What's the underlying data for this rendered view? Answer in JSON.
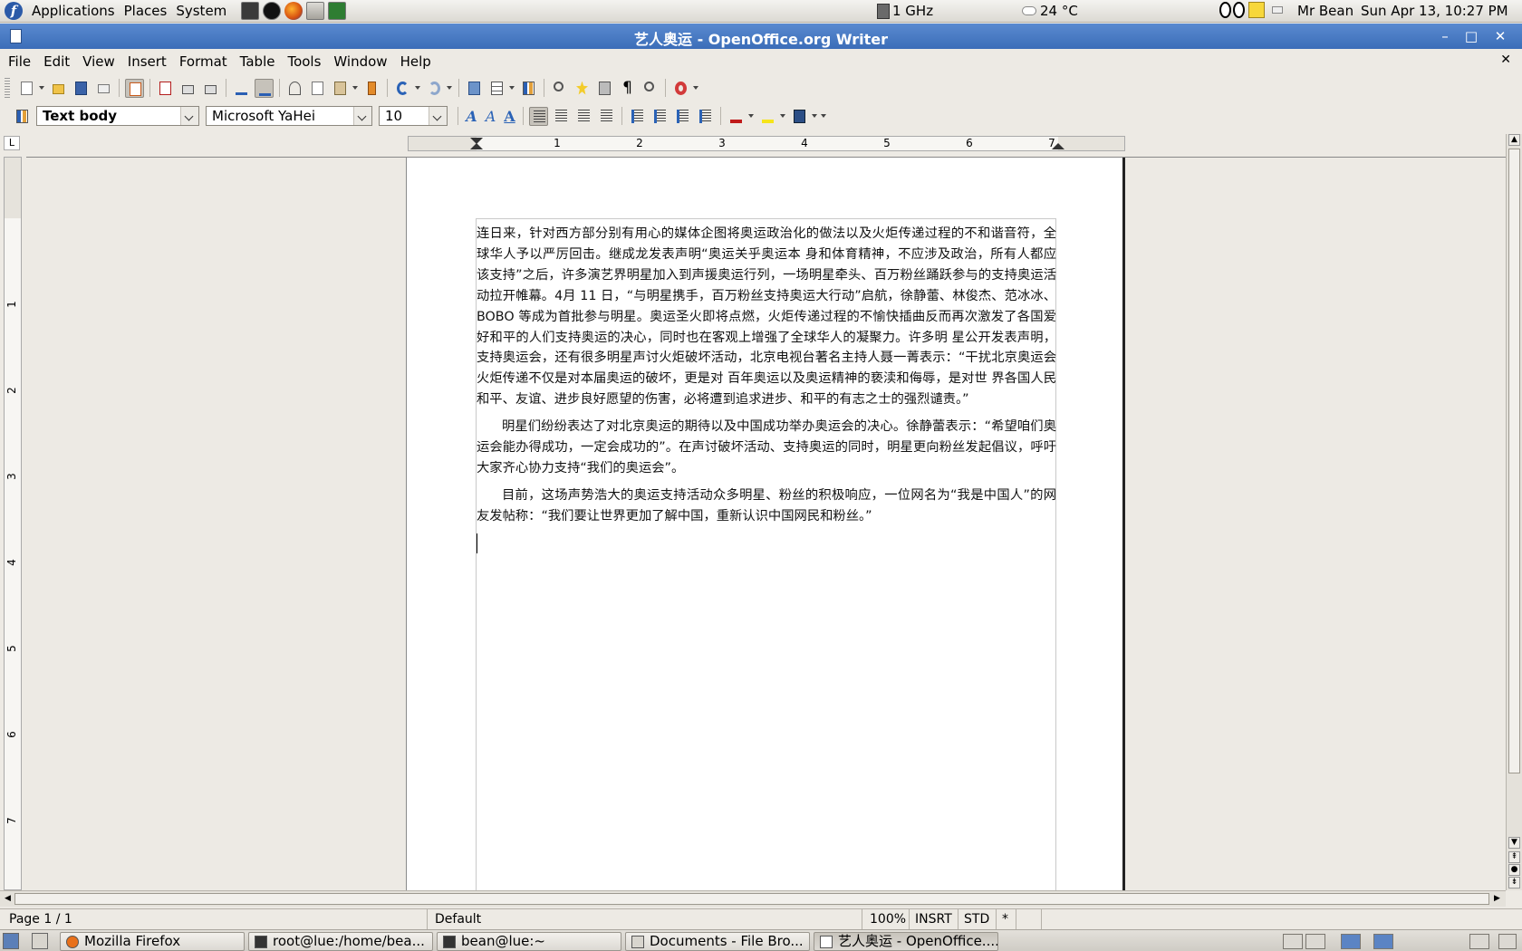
{
  "top_panel": {
    "menus": [
      "Applications",
      "Places",
      "System"
    ],
    "launchers": [
      "terminal-icon",
      "black-circle-icon",
      "firefox-icon",
      "file-manager-icon",
      "system-monitor-icon"
    ],
    "cpu": "1 GHz",
    "weather": "24 °C",
    "user": "Mr Bean",
    "clock": "Sun Apr 13, 10:27 PM"
  },
  "window": {
    "title": "艺人奥运 - OpenOffice.org Writer",
    "minimize": "–",
    "maximize": "□",
    "close": "✕"
  },
  "menubar": {
    "items": [
      "File",
      "Edit",
      "View",
      "Insert",
      "Format",
      "Table",
      "Tools",
      "Window",
      "Help"
    ],
    "close_doc": "✕"
  },
  "format_toolbar": {
    "paragraph_style": "Text body",
    "font_name": "Microsoft YaHei",
    "font_size": "10"
  },
  "ruler": {
    "numbers": [
      "1",
      "2",
      "3",
      "4",
      "5",
      "6",
      "7"
    ],
    "corner": "L",
    "vertical_numbers": [
      "1",
      "2",
      "3",
      "4",
      "5",
      "6",
      "7"
    ]
  },
  "document": {
    "paragraphs": [
      "连日来，针对西方部分别有用心的媒体企图将奥运政治化的做法以及火炬传递过程的不和谐音符，全球华人予以严厉回击。继成龙发表声明“奥运关乎奥运本 身和体育精神，不应涉及政治，所有人都应该支持”之后，许多演艺界明星加入到声援奥运行列，一场明星牵头、百万粉丝踊跃参与的支持奥运活动拉开帷幕。4月 11 日，“与明星携手，百万粉丝支持奥运大行动”启航，徐静蕾、林俊杰、范冰冰、BOBO 等成为首批参与明星。奥运圣火即将点燃，火炬传递过程的不愉快插曲反而再次激发了各国爱好和平的人们支持奥运的决心，同时也在客观上增强了全球华人的凝聚力。许多明 星公开发表声明，支持奥运会，还有很多明星声讨火炬破坏活动，北京电视台著名主持人聂一菁表示：“干扰北京奥运会火炬传递不仅是对本届奥运的破坏，更是对 百年奥运以及奥运精神的亵渎和侮辱，是对世 界各国人民和平、友谊、进步良好愿望的伤害，必将遭到追求进步、和平的有志之士的强烈谴责。”",
      "明星们纷纷表达了对北京奥运的期待以及中国成功举办奥运会的决心。徐静蕾表示：“希望咱们奥运会能办得成功，一定会成功的”。在声讨破坏活动、支持奥运的同时，明星更向粉丝发起倡议，呼吁大家齐心协力支持“我们的奥运会”。",
      "目前，这场声势浩大的奥运支持活动众多明星、粉丝的积极响应，一位网名为“我是中国人”的网友发帖称：“我们要让世界更加了解中国，重新认识中国网民和粉丝。”"
    ]
  },
  "statusbar": {
    "page": "Page 1 / 1",
    "page_style": "Default",
    "zoom": "100%",
    "insert_mode": "INSRT",
    "selection_mode": "STD",
    "modified": "*"
  },
  "taskbar": {
    "tasks": [
      {
        "label": "Mozilla Firefox",
        "icon": "firefox-icon"
      },
      {
        "label": "root@lue:/home/bea...",
        "icon": "terminal-icon"
      },
      {
        "label": "bean@lue:~",
        "icon": "terminal-icon"
      },
      {
        "label": "Documents - File Bro...",
        "icon": "folder-icon"
      },
      {
        "label": "艺人奥运 - OpenOffice....",
        "icon": "writer-icon"
      }
    ]
  },
  "colors": {
    "titlebar": "#3b6db8",
    "panel": "#dcd9d3",
    "page": "#ffffff"
  }
}
